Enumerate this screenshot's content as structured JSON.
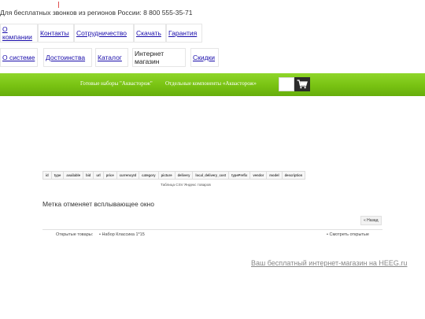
{
  "header": {
    "phone_text": "Для бесплатных звонков из регионов России: 8 800 555-35-71"
  },
  "menu_row1": [
    {
      "id": "about",
      "label": "О компании"
    },
    {
      "id": "contacts",
      "label": "Контакты"
    },
    {
      "id": "cooperation",
      "label": "Сотрудничество"
    },
    {
      "id": "download",
      "label": "Скачать"
    },
    {
      "id": "warranty",
      "label": "Гарантия"
    }
  ],
  "menu_row2": [
    {
      "id": "about-system",
      "label": "О системе"
    },
    {
      "id": "advantages",
      "label": "Достоинства"
    },
    {
      "id": "catalog",
      "label": "Каталог"
    },
    {
      "id": "online-shop",
      "label": "Интернет магазин"
    },
    {
      "id": "discounts",
      "label": "Скидки"
    }
  ],
  "green_bar": {
    "link1": "Готовые наборы \"Аквасторож\"",
    "link2": "Отдельные компоненты «Аквасторож»"
  },
  "table": {
    "columns": [
      "id",
      "type",
      "available",
      "bid",
      "url",
      "price",
      "currencyId",
      "category",
      "picture",
      "delivery",
      "local_delivery_cost",
      "typePrefix",
      "vendor",
      "model",
      "description"
    ],
    "caption": "Таблица CSV Яндекс товаров"
  },
  "popup_note": "Метка отменяет всплывающее окно",
  "back_button": "« Назад",
  "opened": {
    "label": "Открытые товары:",
    "items": [
      "Набор Классика 1*15"
    ],
    "see_link": "Смотреть открытые"
  },
  "footer": {
    "link": "Ваш бесплатный интернет-магазин на HEEG.ru"
  },
  "colors": {
    "green_top": "#8fd62a",
    "green_bottom": "#66ad0c",
    "link": "#1a0dab",
    "cart_button": "#2b2b2b"
  }
}
